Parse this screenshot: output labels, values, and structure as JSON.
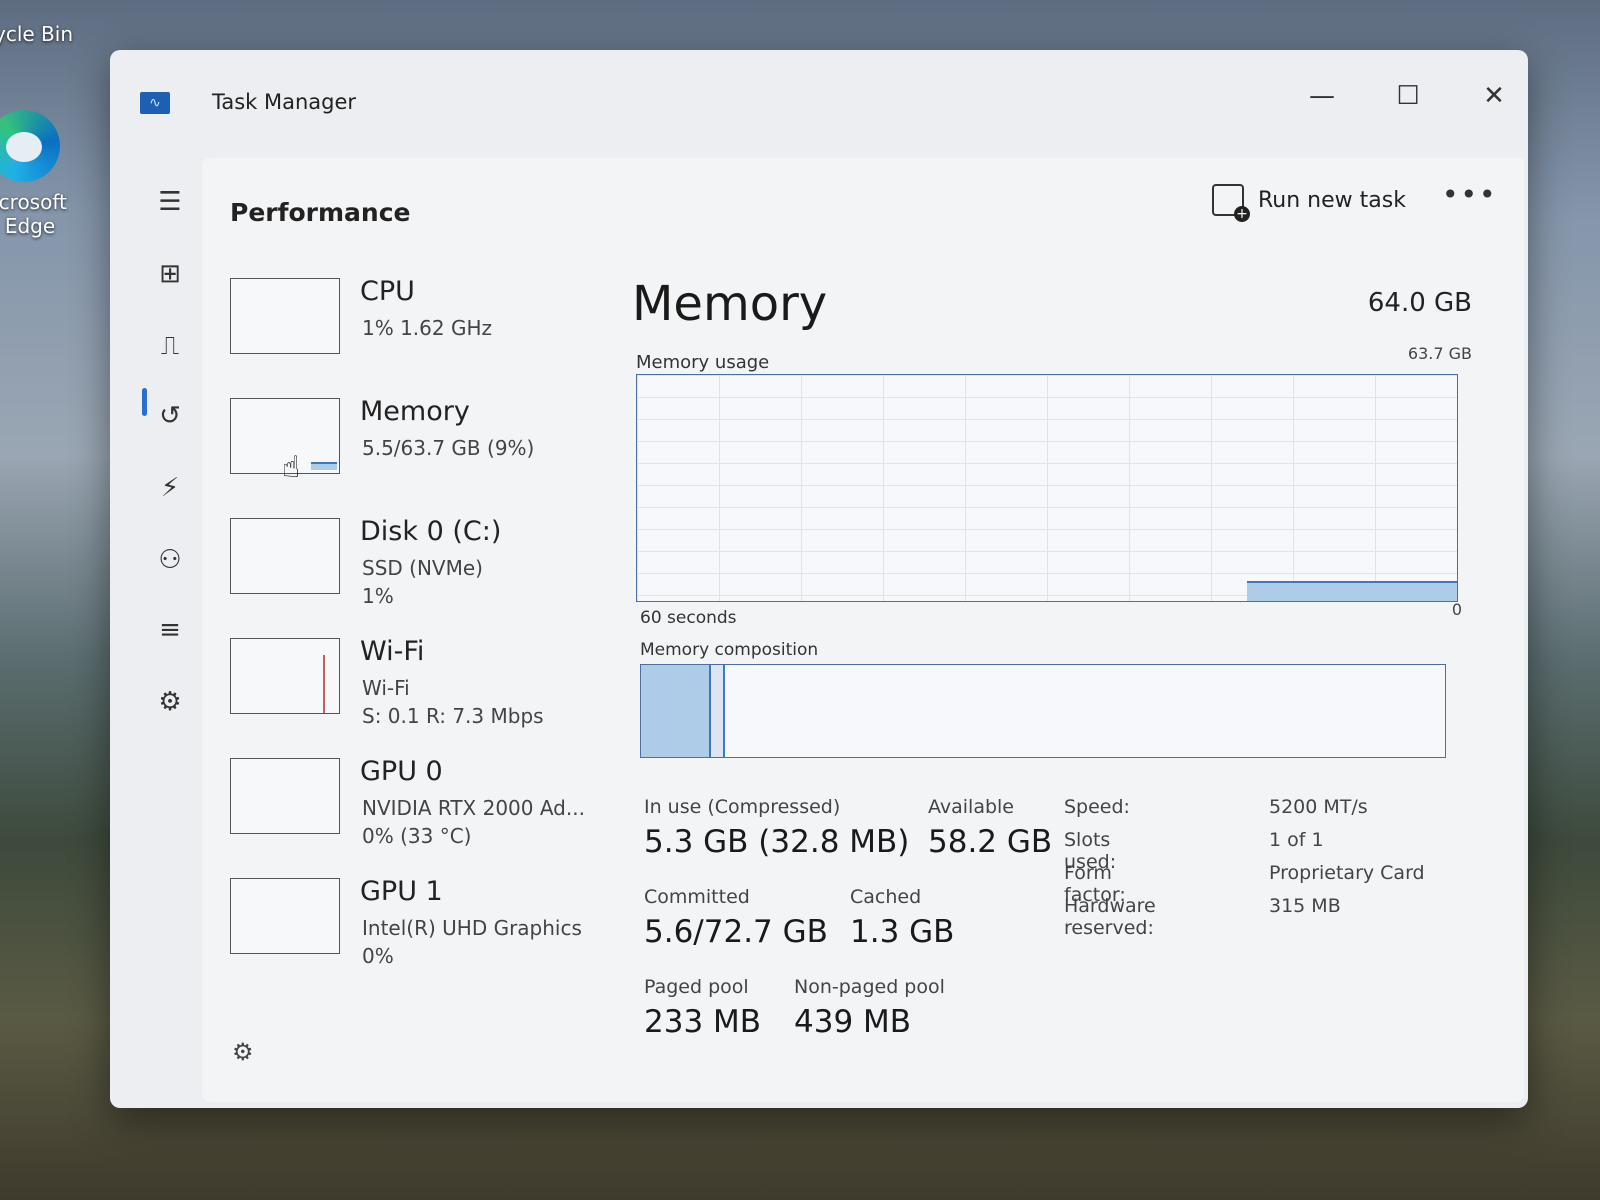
{
  "desktop": {
    "recycle_label": "ycle Bin",
    "edge_label_1": "icrosoft",
    "edge_label_2": "Edge"
  },
  "window": {
    "title": "Task Manager",
    "min_glyph": "—",
    "max_glyph": "☐",
    "close_glyph": "✕"
  },
  "toolbar": {
    "page_title": "Performance",
    "run_new_task": "Run new task",
    "more_glyph": "•••"
  },
  "nav": {
    "icons": [
      "hamburger-menu-icon",
      "processes-icon",
      "performance-icon",
      "app-history-icon",
      "startup-apps-icon",
      "users-icon",
      "details-icon",
      "services-icon",
      "settings-icon"
    ],
    "active": "performance"
  },
  "resources": [
    {
      "name": "CPU",
      "line1": "1%  1.62 GHz",
      "line2": ""
    },
    {
      "name": "Memory",
      "line1": "5.5/63.7 GB (9%)",
      "line2": ""
    },
    {
      "name": "Disk 0 (C:)",
      "line1": "SSD (NVMe)",
      "line2": "1%"
    },
    {
      "name": "Wi-Fi",
      "line1": "Wi-Fi",
      "line2": "S: 0.1  R: 7.3 Mbps"
    },
    {
      "name": "GPU 0",
      "line1": "NVIDIA RTX 2000 Ad...",
      "line2": "0%  (33 °C)"
    },
    {
      "name": "GPU 1",
      "line1": "Intel(R) UHD Graphics",
      "line2": "0%"
    }
  ],
  "memory": {
    "title": "Memory",
    "total": "64.0 GB",
    "usage_label": "Memory usage",
    "usage_max": "63.7 GB",
    "axis_left": "60 seconds",
    "axis_right": "0",
    "composition_label": "Memory composition",
    "usage_fraction": 0.09,
    "colors": {
      "accent": "#3d78c0",
      "fill": "#aecbe8"
    }
  },
  "stats": {
    "in_use_label": "In use (Compressed)",
    "in_use_value": "5.3 GB (32.8 MB)",
    "available_label": "Available",
    "available_value": "58.2 GB",
    "committed_label": "Committed",
    "committed_value": "5.6/72.7 GB",
    "cached_label": "Cached",
    "cached_value": "1.3 GB",
    "paged_label": "Paged pool",
    "paged_value": "233 MB",
    "nonpaged_label": "Non-paged pool",
    "nonpaged_value": "439 MB"
  },
  "specs": [
    {
      "key": "Speed:",
      "value": "5200 MT/s"
    },
    {
      "key": "Slots used:",
      "value": "1 of 1"
    },
    {
      "key": "Form factor:",
      "value": "Proprietary Card"
    },
    {
      "key": "Hardware reserved:",
      "value": "315 MB"
    }
  ]
}
